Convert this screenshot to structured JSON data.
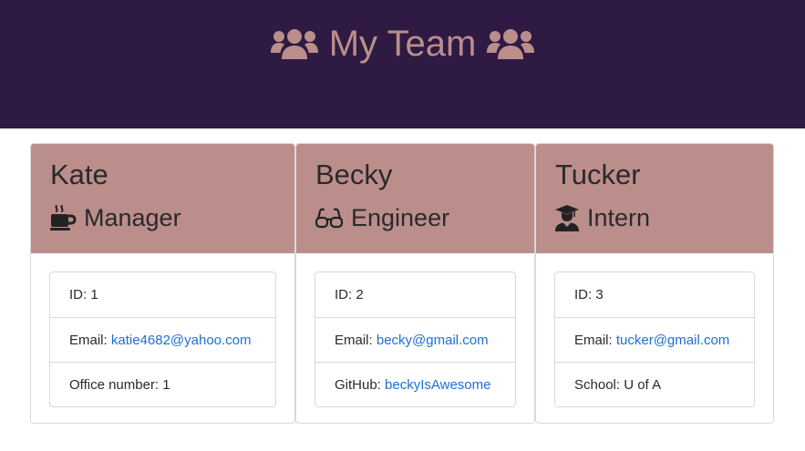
{
  "header": {
    "title": "My Team",
    "icon": "users-icon",
    "colors": {
      "background": "#2e1a42",
      "text": "#bb8e8c"
    }
  },
  "colors": {
    "card_header": "#bb8e8c",
    "link": "#1c6fd8"
  },
  "employees": [
    {
      "name": "Kate",
      "role": "Manager",
      "role_icon": "mug-icon",
      "id_label": "ID:",
      "id": "1",
      "email_label": "Email:",
      "email": "katie4682@yahoo.com",
      "extra_label": "Office number:",
      "extra_value": "1"
    },
    {
      "name": "Becky",
      "role": "Engineer",
      "role_icon": "glasses-icon",
      "id_label": "ID:",
      "id": "2",
      "email_label": "Email:",
      "email": "becky@gmail.com",
      "extra_label": "GitHub:",
      "extra_value": "beckyIsAwesome"
    },
    {
      "name": "Tucker",
      "role": "Intern",
      "role_icon": "graduate-icon",
      "id_label": "ID:",
      "id": "3",
      "email_label": "Email:",
      "email": "tucker@gmail.com",
      "extra_label": "School:",
      "extra_value": "U of A"
    }
  ]
}
